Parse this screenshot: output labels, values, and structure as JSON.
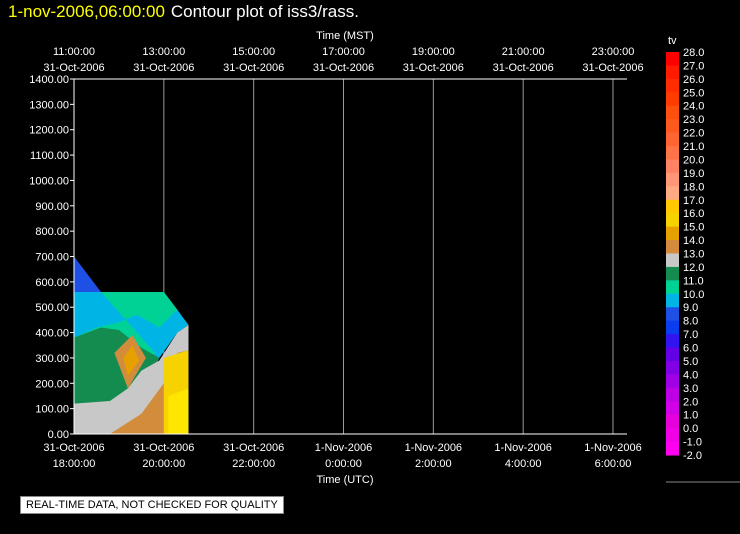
{
  "header": {
    "timestamp": "1-nov-2006,06:00:00",
    "title": "Contour plot of iss3/rass."
  },
  "disclaimer": "REAL-TIME DATA, NOT CHECKED FOR QUALITY",
  "chart_data": {
    "type": "heatmap",
    "top_axis_label": "Time (MST)",
    "bottom_axis_label": "Time (UTC)",
    "top_ticks": [
      {
        "time": "11:00:00",
        "date": "31-Oct-2006"
      },
      {
        "time": "13:00:00",
        "date": "31-Oct-2006"
      },
      {
        "time": "15:00:00",
        "date": "31-Oct-2006"
      },
      {
        "time": "17:00:00",
        "date": "31-Oct-2006"
      },
      {
        "time": "19:00:00",
        "date": "31-Oct-2006"
      },
      {
        "time": "21:00:00",
        "date": "31-Oct-2006"
      },
      {
        "time": "23:00:00",
        "date": "31-Oct-2006"
      }
    ],
    "bottom_ticks": [
      {
        "date": "31-Oct-2006",
        "time": "18:00:00"
      },
      {
        "date": "31-Oct-2006",
        "time": "20:00:00"
      },
      {
        "date": "31-Oct-2006",
        "time": "22:00:00"
      },
      {
        "date": "1-Nov-2006",
        "time": "0:00:00"
      },
      {
        "date": "1-Nov-2006",
        "time": "2:00:00"
      },
      {
        "date": "1-Nov-2006",
        "time": "4:00:00"
      },
      {
        "date": "1-Nov-2006",
        "time": "6:00:00"
      }
    ],
    "y_ticks": [
      "0.00",
      "100.00",
      "200.00",
      "300.00",
      "400.00",
      "500.00",
      "600.00",
      "700.00",
      "800.00",
      "900.00",
      "1000.00",
      "1100.00",
      "1200.00",
      "1300.00",
      "1400.00"
    ],
    "xlim_hours_utc": [
      18,
      30
    ],
    "ylim": [
      0,
      1400
    ],
    "grid": "vertical",
    "colorbar": {
      "label": "tv",
      "levels": [
        "28.0",
        "27.0",
        "26.0",
        "25.0",
        "24.0",
        "23.0",
        "22.0",
        "21.0",
        "20.0",
        "19.0",
        "18.0",
        "17.0",
        "16.0",
        "15.0",
        "14.0",
        "13.0",
        "12.0",
        "11.0",
        "10.0",
        "9.0",
        "8.0",
        "7.0",
        "6.0",
        "5.0",
        "4.0",
        "3.0",
        "2.0",
        "1.0",
        "0.0",
        "-1.0",
        "-2.0"
      ],
      "colors": [
        "#ff0000",
        "#ff1a00",
        "#ff2d00",
        "#ff3c00",
        "#ff4f0f",
        "#ff5a1e",
        "#ff6432",
        "#ff7346",
        "#ff8264",
        "#ff9678",
        "#ffaa82",
        "#ffc800",
        "#f5d200",
        "#e6a000",
        "#d28c3c",
        "#c8c8c8",
        "#148c50",
        "#00d296",
        "#00b4e6",
        "#1e50e6",
        "#0a3cf0",
        "#3214f0",
        "#6400e6",
        "#8200e6",
        "#a000e6",
        "#be00e6",
        "#d200e6",
        "#e600dc",
        "#f000e6",
        "#ff00f0"
      ]
    },
    "contour_regions": [
      {
        "level": "9.0",
        "color": "#1e50e6",
        "points": [
          [
            18.0,
            700
          ],
          [
            18.6,
            560
          ],
          [
            18.0,
            560
          ]
        ]
      },
      {
        "level": "10.0",
        "color": "#00b4e6",
        "points": [
          [
            18.0,
            560
          ],
          [
            20.0,
            560
          ],
          [
            20.3,
            490
          ],
          [
            20.55,
            430
          ],
          [
            20.3,
            400
          ],
          [
            19.9,
            300
          ],
          [
            19.5,
            150
          ],
          [
            18.8,
            100
          ],
          [
            18.0,
            100
          ]
        ]
      },
      {
        "level": "11.0",
        "color": "#00d296",
        "points": [
          [
            18.6,
            560
          ],
          [
            20.0,
            560
          ],
          [
            20.3,
            490
          ],
          [
            19.9,
            420
          ],
          [
            19.4,
            470
          ],
          [
            19.0,
            440
          ],
          [
            18.5,
            420
          ],
          [
            18.0,
            380
          ],
          [
            18.0,
            100
          ],
          [
            19.0,
            100
          ],
          [
            19.6,
            170
          ],
          [
            19.8,
            320
          ]
        ]
      },
      {
        "level": "12.0",
        "color": "#148c50",
        "points": [
          [
            18.0,
            380
          ],
          [
            18.6,
            420
          ],
          [
            19.0,
            410
          ],
          [
            19.5,
            340
          ],
          [
            19.9,
            300
          ],
          [
            19.4,
            150
          ],
          [
            18.9,
            100
          ],
          [
            18.0,
            100
          ]
        ]
      },
      {
        "level": "13.0",
        "color": "#c8c8c8",
        "points": [
          [
            18.0,
            120
          ],
          [
            18.8,
            130
          ],
          [
            19.2,
            180
          ],
          [
            19.5,
            250
          ],
          [
            19.9,
            290
          ],
          [
            20.3,
            400
          ],
          [
            20.55,
            430
          ],
          [
            20.55,
            0
          ],
          [
            18.0,
            0
          ]
        ]
      },
      {
        "level": "14.0",
        "color": "#d28c3c",
        "points": [
          [
            18.9,
            320
          ],
          [
            19.3,
            390
          ],
          [
            19.6,
            300
          ],
          [
            19.2,
            180
          ]
        ]
      },
      {
        "level": "15.0",
        "color": "#e6a000",
        "points": [
          [
            19.1,
            300
          ],
          [
            19.3,
            350
          ],
          [
            19.45,
            290
          ],
          [
            19.2,
            230
          ]
        ]
      },
      {
        "level": "15.0",
        "color": "#d28c3c",
        "points": [
          [
            18.8,
            0
          ],
          [
            19.5,
            80
          ],
          [
            20.0,
            200
          ],
          [
            20.3,
            320
          ],
          [
            20.55,
            330
          ],
          [
            20.55,
            0
          ]
        ]
      },
      {
        "level": "16.0",
        "color": "#f5d200",
        "points": [
          [
            20.0,
            0
          ],
          [
            20.0,
            300
          ],
          [
            20.55,
            330
          ],
          [
            20.55,
            0
          ]
        ]
      },
      {
        "level": "17.0",
        "color": "#ffe600",
        "points": [
          [
            20.1,
            0
          ],
          [
            20.1,
            150
          ],
          [
            20.55,
            180
          ],
          [
            20.55,
            0
          ]
        ]
      }
    ]
  }
}
